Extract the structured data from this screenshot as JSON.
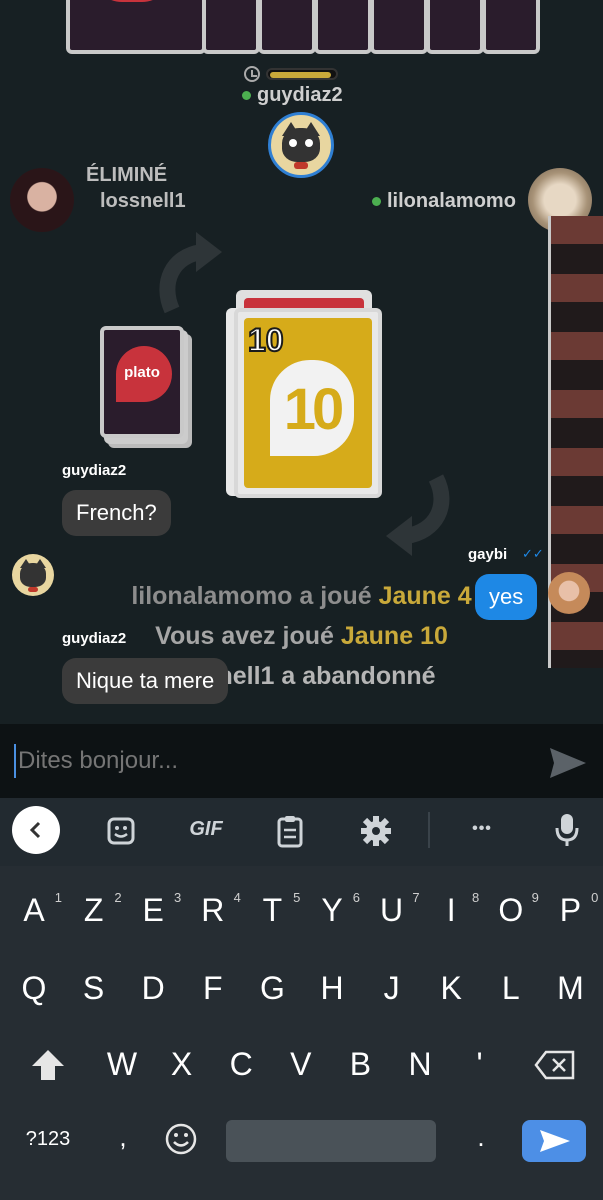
{
  "top_player": {
    "name": "guydiaz2",
    "timer_progress": 0.9
  },
  "left_player": {
    "status": "ÉLIMINÉ",
    "name": "lossnell1"
  },
  "right_player": {
    "name": "lilonalamomo"
  },
  "pile": {
    "brand": "plato"
  },
  "played_card": {
    "corner": "10",
    "center": "10",
    "color": "#d6ab1a"
  },
  "game_log": [
    {
      "prefix": "lilonalamomo a joué ",
      "highlight": "Jaune 4"
    },
    {
      "prefix": "Vous avez joué ",
      "highlight": "Jaune 10"
    },
    {
      "prefix": "lossnell1 a abandonné",
      "highlight": ""
    }
  ],
  "chat": [
    {
      "user": "guydiaz2",
      "text": "French?"
    },
    {
      "user": "gaybi",
      "text": "yes",
      "read_receipt": "✓✓"
    },
    {
      "user": "guydiaz2",
      "text": "Nique ta mere"
    }
  ],
  "input": {
    "placeholder": "Dites bonjour..."
  },
  "toolbar": {
    "gif": "GIF",
    "more": "•••"
  },
  "keyboard": {
    "row1": [
      {
        "k": "A",
        "n": "1"
      },
      {
        "k": "Z",
        "n": "2"
      },
      {
        "k": "E",
        "n": "3"
      },
      {
        "k": "R",
        "n": "4"
      },
      {
        "k": "T",
        "n": "5"
      },
      {
        "k": "Y",
        "n": "6"
      },
      {
        "k": "U",
        "n": "7"
      },
      {
        "k": "I",
        "n": "8"
      },
      {
        "k": "O",
        "n": "9"
      },
      {
        "k": "P",
        "n": "0"
      }
    ],
    "row2": [
      "Q",
      "S",
      "D",
      "F",
      "G",
      "H",
      "J",
      "K",
      "L",
      "M"
    ],
    "row3": [
      "W",
      "X",
      "C",
      "V",
      "B",
      "N",
      "'"
    ],
    "numbers_key": "?123",
    "comma": ",",
    "period": "."
  },
  "colors": {
    "accent_blue": "#1e88e5",
    "card_yellow": "#d6ab1a",
    "brand_red": "#c8333c",
    "online_green": "#4caf50"
  }
}
